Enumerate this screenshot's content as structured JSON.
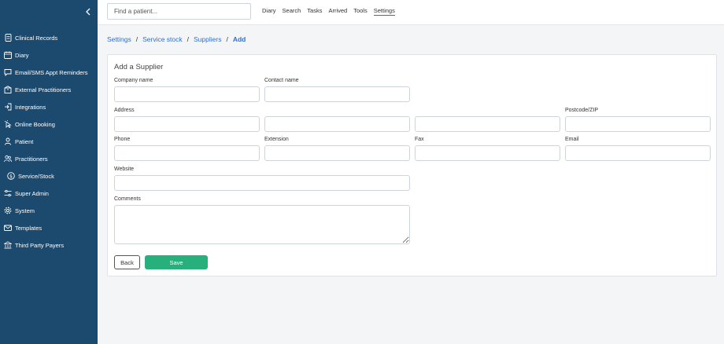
{
  "sidebar": {
    "items": [
      {
        "label": "Clinical Records",
        "icon": "document-icon"
      },
      {
        "label": "Diary",
        "icon": "calendar-icon"
      },
      {
        "label": "Email/SMS Appt Reminders",
        "icon": "message-icon"
      },
      {
        "label": "External Practitioners",
        "icon": "building-icon"
      },
      {
        "label": "Integrations",
        "icon": "login-icon"
      },
      {
        "label": "Online Booking",
        "icon": "pointer-icon"
      },
      {
        "label": "Patient",
        "icon": "person-icon"
      },
      {
        "label": "Practitioners",
        "icon": "people-icon"
      },
      {
        "label": "Service/Stock",
        "icon": "dollar-icon"
      },
      {
        "label": "Super Admin",
        "icon": "sliders-icon"
      },
      {
        "label": "System",
        "icon": "gear-icon"
      },
      {
        "label": "Templates",
        "icon": "envelope-icon"
      },
      {
        "label": "Third Party Payers",
        "icon": "bank-icon"
      }
    ]
  },
  "topbar": {
    "search_placeholder": "Find a patient...",
    "menu": [
      "Diary",
      "Search",
      "Tasks",
      "Arrived",
      "Tools",
      "Settings"
    ],
    "active_menu": "Settings"
  },
  "breadcrumb": [
    "Settings",
    "Service stock",
    "Suppliers",
    "Add"
  ],
  "form": {
    "title": "Add a Supplier",
    "labels": {
      "company_name": "Company name",
      "contact_name": "Contact name",
      "address": "Address",
      "postcode": "Postcode/ZIP",
      "phone": "Phone",
      "extension": "Extension",
      "fax": "Fax",
      "email": "Email",
      "website": "Website",
      "comments": "Comments"
    },
    "values": {
      "company_name": "",
      "contact_name": "",
      "address_1": "",
      "address_2": "",
      "address_3": "",
      "postcode": "",
      "phone": "",
      "extension": "",
      "fax": "",
      "email": "",
      "website": "",
      "comments": ""
    },
    "back_label": "Back",
    "save_label": "Save"
  },
  "colors": {
    "sidebar_bg": "#1c4a6e",
    "link": "#2f6fcf",
    "save_button": "#27b07c"
  }
}
